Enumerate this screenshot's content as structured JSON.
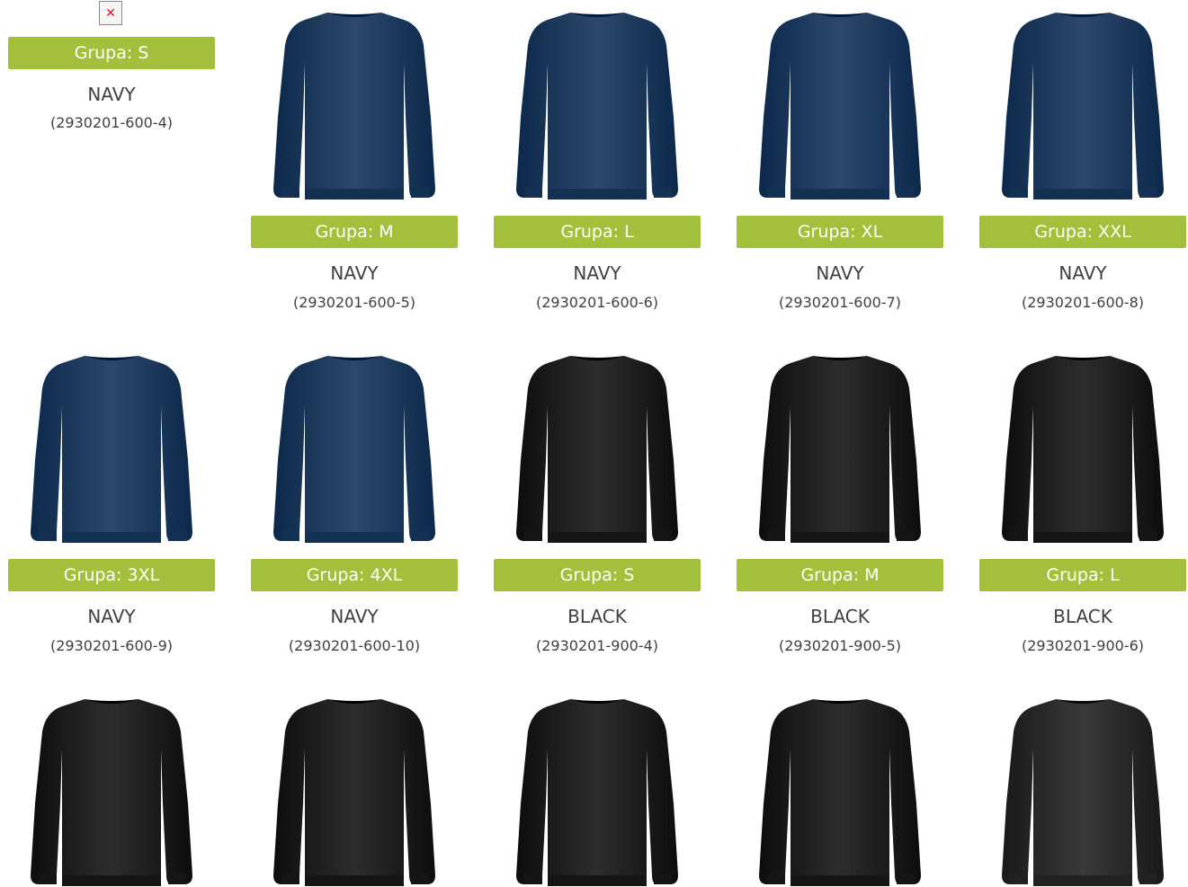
{
  "colors": {
    "badge": "#a3c03c",
    "navy": "#1e3a5c",
    "black": "#1f1f1f",
    "charcoal": "#2b2b2b"
  },
  "products": [
    {
      "group": "Grupa: S",
      "color": "NAVY",
      "code": "(2930201-600-4)",
      "image": "broken-image-icon"
    },
    {
      "group": "Grupa: M",
      "color": "NAVY",
      "code": "(2930201-600-5)",
      "image": "navy-sweater"
    },
    {
      "group": "Grupa: L",
      "color": "NAVY",
      "code": "(2930201-600-6)",
      "image": "navy-sweater"
    },
    {
      "group": "Grupa: XL",
      "color": "NAVY",
      "code": "(2930201-600-7)",
      "image": "navy-sweater"
    },
    {
      "group": "Grupa: XXL",
      "color": "NAVY",
      "code": "(2930201-600-8)",
      "image": "navy-sweater"
    },
    {
      "group": "Grupa: 3XL",
      "color": "NAVY",
      "code": "(2930201-600-9)",
      "image": "navy-sweater"
    },
    {
      "group": "Grupa: 4XL",
      "color": "NAVY",
      "code": "(2930201-600-10)",
      "image": "navy-sweater"
    },
    {
      "group": "Grupa: S",
      "color": "BLACK",
      "code": "(2930201-900-4)",
      "image": "black-sweater"
    },
    {
      "group": "Grupa: M",
      "color": "BLACK",
      "code": "(2930201-900-5)",
      "image": "black-sweater"
    },
    {
      "group": "Grupa: L",
      "color": "BLACK",
      "code": "(2930201-900-6)",
      "image": "black-sweater"
    },
    {
      "image": "black-sweater"
    },
    {
      "image": "black-sweater"
    },
    {
      "image": "black-sweater"
    },
    {
      "image": "black-sweater"
    },
    {
      "image": "charcoal-sweater"
    }
  ]
}
